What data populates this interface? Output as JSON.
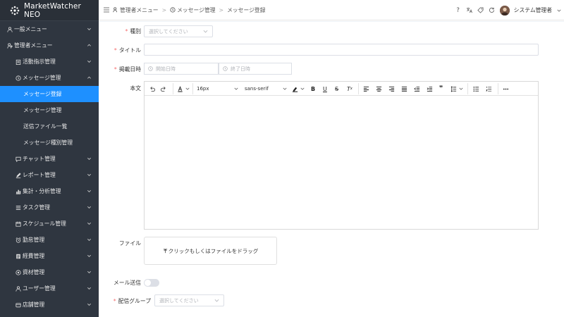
{
  "app": {
    "brand": "MarketWatcher NEO"
  },
  "sidebar": {
    "items": [
      {
        "label": "一般メニュー",
        "level": 1,
        "icon": "user-icon",
        "expanded": false
      },
      {
        "label": "管理者メニュー",
        "level": 1,
        "icon": "admin-icon",
        "expanded": true
      },
      {
        "label": "活動指示管理",
        "level": 2,
        "icon": "clipboard-icon",
        "expanded": false
      },
      {
        "label": "メッセージ管理",
        "level": 2,
        "icon": "clock-icon",
        "expanded": true
      },
      {
        "label": "メッセージ登録",
        "level": 3,
        "active": true
      },
      {
        "label": "メッセージ管理",
        "level": 3
      },
      {
        "label": "送信ファイル一覧",
        "level": 3
      },
      {
        "label": "メッセージ種別管理",
        "level": 3
      },
      {
        "label": "チャット管理",
        "level": 2,
        "icon": "chat-icon",
        "expanded": false
      },
      {
        "label": "レポート管理",
        "level": 2,
        "icon": "pen-icon",
        "expanded": false
      },
      {
        "label": "集計・分析管理",
        "level": 2,
        "icon": "chart-icon",
        "expanded": false
      },
      {
        "label": "タスク管理",
        "level": 2,
        "icon": "list-icon",
        "expanded": false
      },
      {
        "label": "スケジュール管理",
        "level": 2,
        "icon": "calendar-icon",
        "expanded": false
      },
      {
        "label": "勤怠管理",
        "level": 2,
        "icon": "alarm-icon",
        "expanded": false
      },
      {
        "label": "経費管理",
        "level": 2,
        "icon": "receipt-icon",
        "expanded": false
      },
      {
        "label": "資材管理",
        "level": 2,
        "icon": "box-icon",
        "expanded": false
      },
      {
        "label": "ユーザー管理",
        "level": 2,
        "icon": "user-icon",
        "expanded": false
      },
      {
        "label": "店舗管理",
        "level": 2,
        "icon": "store-icon",
        "expanded": false
      }
    ]
  },
  "header": {
    "breadcrumbs": [
      "管理者メニュー",
      "メッセージ管理",
      "メッセージ登録"
    ],
    "breadcrumb_separator": ">",
    "user_name": "システム管理者"
  },
  "form": {
    "type_label": "種別",
    "type_placeholder": "選択してください",
    "title_label": "タイトル",
    "title_value": "",
    "period_label": "掲載日時",
    "start_placeholder": "開始日時",
    "end_placeholder": "終了日時",
    "body_label": "本文",
    "editor": {
      "font_size": "16px",
      "font_family": "sans-serif"
    },
    "file_label": "ファイル",
    "upload_text": "クリックもしくはファイルをドラッグ",
    "mail_label": "メール送信",
    "mail_enabled": false,
    "group_label": "配信グループ",
    "group_placeholder": "選択してください"
  },
  "colors": {
    "sidebar_bg": "#2f3640",
    "active": "#1e90ff",
    "required": "#f56c6c"
  }
}
